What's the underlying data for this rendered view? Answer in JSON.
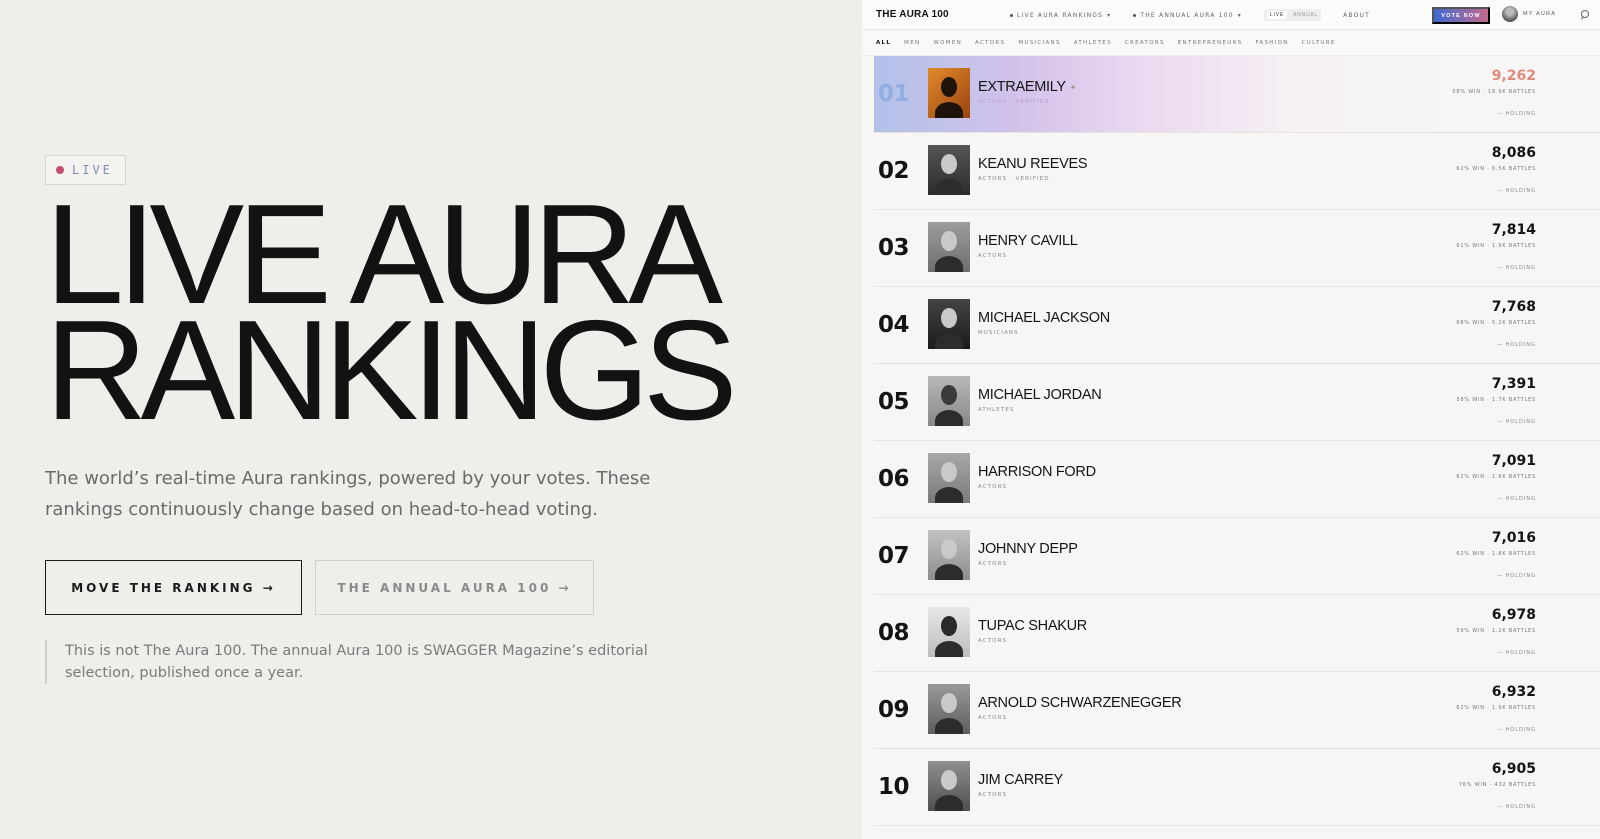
{
  "hero": {
    "badge": "LIVE",
    "headline_line1": "LIVE AURA",
    "headline_line2": "RANKINGS",
    "subtext": "The world’s real-time Aura rankings, powered by your votes. These rankings continuously change based on head-to-head voting.",
    "cta_primary": "MOVE THE RANKING →",
    "cta_secondary": "THE ANNUAL AURA 100 →",
    "note": "This is not The Aura 100. The annual Aura 100 is SWAGGER Magazine’s editorial selection, published once a year."
  },
  "topbar": {
    "brand": "THE AURA 100",
    "nav_live": "LIVE AURA RANKINGS",
    "nav_annual": "THE ANNUAL AURA 100",
    "toggle_on": "LIVE",
    "toggle_off": "ANNUAL",
    "about": "ABOUT",
    "vote": "VOTE NOW",
    "my_aura": "MY AURA"
  },
  "categories": [
    "ALL",
    "MEN",
    "WOMEN",
    "ACTORS",
    "MUSICIANS",
    "ATHLETES",
    "CREATORS",
    "ENTREPRENEURS",
    "FASHION",
    "CULTURE"
  ],
  "rankings": [
    {
      "rank": "01",
      "name": "EXTRAEMILY",
      "meta": "ACTORS · VERIFIED",
      "score": "9,262",
      "stats": "58% WIN · 18.9K BATTLES",
      "trend": "— HOLDING"
    },
    {
      "rank": "02",
      "name": "KEANU REEVES",
      "meta": "ACTORS · VERIFIED",
      "score": "8,086",
      "stats": "62% WIN · 6.5K BATTLES",
      "trend": "— HOLDING"
    },
    {
      "rank": "03",
      "name": "HENRY CAVILL",
      "meta": "ACTORS",
      "score": "7,814",
      "stats": "61% WIN · 1.9K BATTLES",
      "trend": "— HOLDING"
    },
    {
      "rank": "04",
      "name": "MICHAEL JACKSON",
      "meta": "MUSICIANS",
      "score": "7,768",
      "stats": "68% WIN · 5.2K BATTLES",
      "trend": "— HOLDING"
    },
    {
      "rank": "05",
      "name": "MICHAEL JORDAN",
      "meta": "ATHLETES",
      "score": "7,391",
      "stats": "58% WIN · 1.7K BATTLES",
      "trend": "— HOLDING"
    },
    {
      "rank": "06",
      "name": "HARRISON FORD",
      "meta": "ACTORS",
      "score": "7,091",
      "stats": "62% WIN · 1.6K BATTLES",
      "trend": "— HOLDING"
    },
    {
      "rank": "07",
      "name": "JOHNNY DEPP",
      "meta": "ACTORS",
      "score": "7,016",
      "stats": "62% WIN · 1.8K BATTLES",
      "trend": "— HOLDING"
    },
    {
      "rank": "08",
      "name": "TUPAC SHAKUR",
      "meta": "ACTORS",
      "score": "6,978",
      "stats": "59% WIN · 1.2K BATTLES",
      "trend": "— HOLDING"
    },
    {
      "rank": "09",
      "name": "ARNOLD SCHWARZENEGGER",
      "meta": "ACTORS",
      "score": "6,932",
      "stats": "62% WIN · 1.9K BATTLES",
      "trend": "— HOLDING"
    },
    {
      "rank": "10",
      "name": "JIM CARREY",
      "meta": "ACTORS",
      "score": "6,905",
      "stats": "76% WIN · 432 BATTLES",
      "trend": "— HOLDING"
    }
  ],
  "colors": {
    "accent_gradient_start": "#3e6ad0",
    "accent_gradient_end": "#c56a8c",
    "live_dot": "#c44c72",
    "top_score": "#e08a7a"
  }
}
